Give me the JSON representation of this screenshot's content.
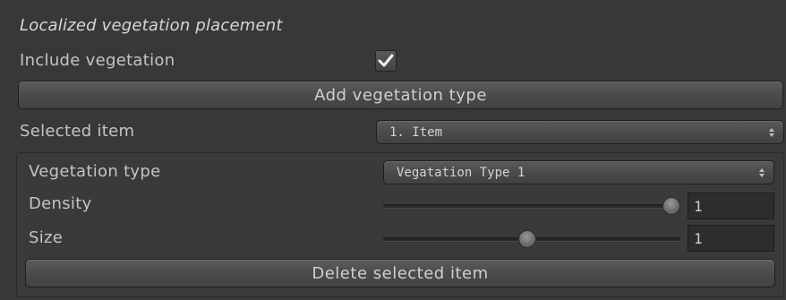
{
  "section": {
    "title": "Localized vegetation placement"
  },
  "include_vegetation": {
    "label": "Include vegetation",
    "checked": true
  },
  "add_button": {
    "label": "Add vegetation type"
  },
  "selected_item": {
    "label": "Selected item",
    "value": "1. Item"
  },
  "item_settings": {
    "vegetation_type": {
      "label": "Vegetation type",
      "value": "Vegatation Type 1"
    },
    "density": {
      "label": "Density",
      "value": "1",
      "slider_fraction": 1.0
    },
    "size": {
      "label": "Size",
      "value": "1",
      "slider_fraction": 0.5
    }
  },
  "delete_button": {
    "label": "Delete selected item"
  },
  "icons": {
    "checkbox": "checkmark-icon",
    "dropdown": "up-down-arrows-icon"
  }
}
